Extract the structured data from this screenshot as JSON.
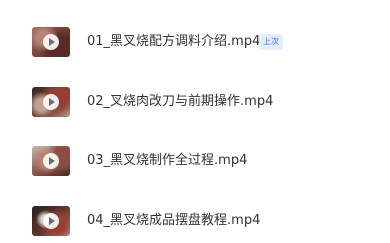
{
  "files": [
    {
      "name": "01_黑叉烧配方调料介绍.mp4",
      "badge": "上次",
      "thumb_icon": "play-icon"
    },
    {
      "name": "02_叉烧肉改刀与前期操作.mp4",
      "thumb_icon": "play-icon"
    },
    {
      "name": "03_黑叉烧制作全过程.mp4",
      "thumb_icon": "play-icon"
    },
    {
      "name": "04_黑叉烧成品摆盘教程.mp4",
      "thumb_icon": "play-icon"
    }
  ],
  "colors": {
    "text": "#333333",
    "badge_text": "#3b6fd6",
    "badge_bg": "#e3edfc"
  }
}
